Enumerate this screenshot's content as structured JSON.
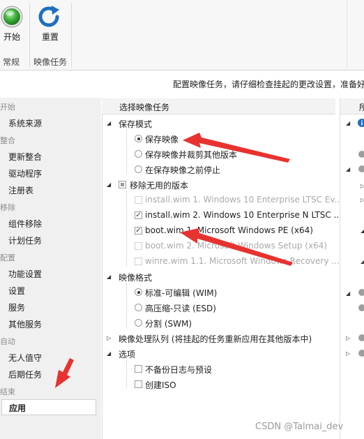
{
  "ribbon": {
    "start_label": "开始",
    "reset_label": "重置",
    "group_general": "常规",
    "group_image_tasks": "映像任务"
  },
  "hint": "配置映像任务，请仔细检查挂起的更改设置，准备好",
  "nav": {
    "cat_start": "开始",
    "system_source": "系统来源",
    "cat_integrate": "整合",
    "update_integrate": "更新整合",
    "driver": "驱动程序",
    "registry": "注册表",
    "cat_remove": "移除",
    "component_remove": "组件移除",
    "scheduled_tasks": "计划任务",
    "cat_config": "配置",
    "feature_settings": "功能设置",
    "settings": "设置",
    "services": "服务",
    "other_services": "其他服务",
    "cat_auto": "自动",
    "unattended": "无人值守",
    "post_tasks": "后期任务",
    "cat_end": "结束",
    "apply": "应用"
  },
  "panel": {
    "header": "选择映像任务",
    "save_mode": "保存模式",
    "save_image": "保存映像",
    "save_and_trim": "保存映像并裁剪其他版本",
    "stop_before_save": "在保存映像之前停止",
    "remove_unused": "移除无用的版本",
    "editions": [
      {
        "label": "install.wim 1. Windows 10 Enterprise LTSC Ev...",
        "checked": false,
        "disabled": true
      },
      {
        "label": "install.wim 2. Windows 10 Enterprise N LTSC ...",
        "checked": true,
        "disabled": false
      },
      {
        "label": "boot.wim 1. Microsoft Windows PE (x64)",
        "checked": true,
        "disabled": false
      },
      {
        "label": "boot.wim 2. Microsoft Windows Setup (x64)",
        "checked": false,
        "disabled": true
      },
      {
        "label": "winre.wim 1.1. Microsoft Windows Recovery ...",
        "checked": false,
        "disabled": true
      }
    ],
    "image_format": "映像格式",
    "format_wim": "标准-可编辑 (WIM)",
    "format_esd": "高压缩-只读 (ESD)",
    "format_swm": "分割 (SWM)",
    "queue": "映像处理队列 (将挂起的任务重新应用在其他版本中)",
    "options": "选项",
    "no_backup_log": "不备份日志与预设",
    "create_iso": "创建ISO"
  },
  "right_header": "所",
  "watermark": "CSDN @Talmai_dev",
  "colors": {
    "arrow_red": "#e8322f",
    "start_green": "#3fb33f",
    "reset_blue": "#1e6fc0"
  }
}
